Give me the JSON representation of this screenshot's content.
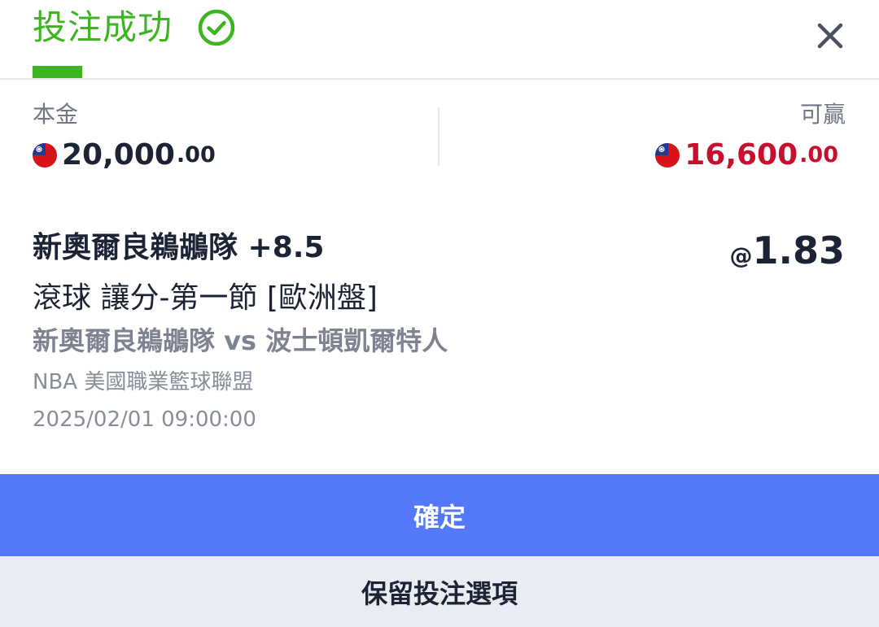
{
  "header": {
    "title": "投注成功",
    "success_icon": "check-circle-icon",
    "close_icon": "close-icon"
  },
  "amounts": {
    "stake": {
      "label": "本金",
      "currency_icon": "taiwan-flag-icon",
      "integer": "20,000",
      "decimal": ".00"
    },
    "potential_win": {
      "label": "可贏",
      "currency_icon": "taiwan-flag-icon",
      "integer": "16,600",
      "decimal": ".00"
    }
  },
  "bet": {
    "selection": "新奧爾良鵜鶘隊 +8.5",
    "odds_prefix": "@",
    "odds": "1.83",
    "market": "滾球 讓分-第一節 [歐洲盤]",
    "match": "新奧爾良鵜鶘隊 vs 波士頓凱爾特人",
    "league": "NBA 美國職業籃球聯盟",
    "datetime": "2025/02/01 09:00:00"
  },
  "buttons": {
    "confirm_label": "確定",
    "keep_label": "保留投注選項"
  },
  "colors": {
    "success_green": "#3cb521",
    "primary_blue": "#5478fa",
    "win_red": "#c8102e",
    "text_dark": "#1c2335"
  }
}
